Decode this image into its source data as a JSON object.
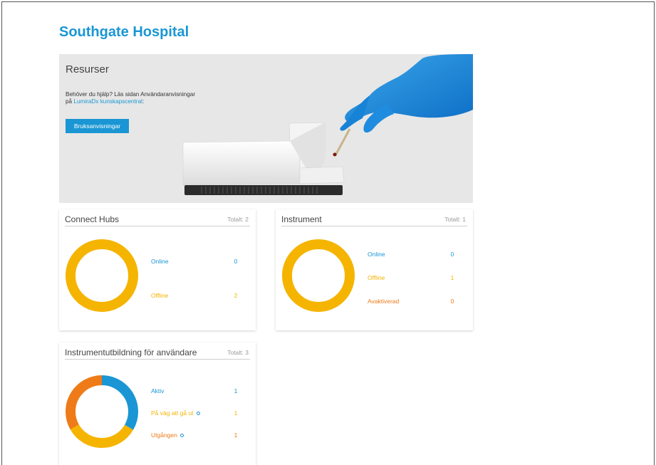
{
  "header": {
    "title": "Southgate Hospital"
  },
  "resources": {
    "title": "Resurser",
    "help_line1": "Behöver du hjälp? Läs sidan Användaranvisningar",
    "help_prefix": "på ",
    "help_link": "LumiraDx kunskapscentral",
    "help_suffix": ":",
    "button_label": "Bruksanvisningar"
  },
  "hubs": {
    "title": "Connect Hubs",
    "total": "Totalt: 2",
    "rows": [
      {
        "label": "Online",
        "value": "0",
        "color": "#1a96d4"
      },
      {
        "label": "Offline",
        "value": "2",
        "color": "#f5b400"
      }
    ]
  },
  "instruments": {
    "title": "Instrument",
    "total": "Totalt: 1",
    "rows": [
      {
        "label": "Online",
        "value": "0",
        "color": "#1a96d4"
      },
      {
        "label": "Offline",
        "value": "1",
        "color": "#f5b400"
      },
      {
        "label": "Avaktiverad",
        "value": "0",
        "color": "#ee7b17"
      }
    ]
  },
  "training": {
    "title": "Instrumentutbildning för användare",
    "total": "Totalt: 3",
    "rows": [
      {
        "label": "Aktiv",
        "value": "1",
        "color": "#1a96d4"
      },
      {
        "label": "På väg att gå ut",
        "value": "1",
        "color": "#f5b400"
      },
      {
        "label": "Utgången",
        "value": "1",
        "color": "#ee7b17"
      }
    ]
  },
  "icons": [
    "info-icon"
  ]
}
